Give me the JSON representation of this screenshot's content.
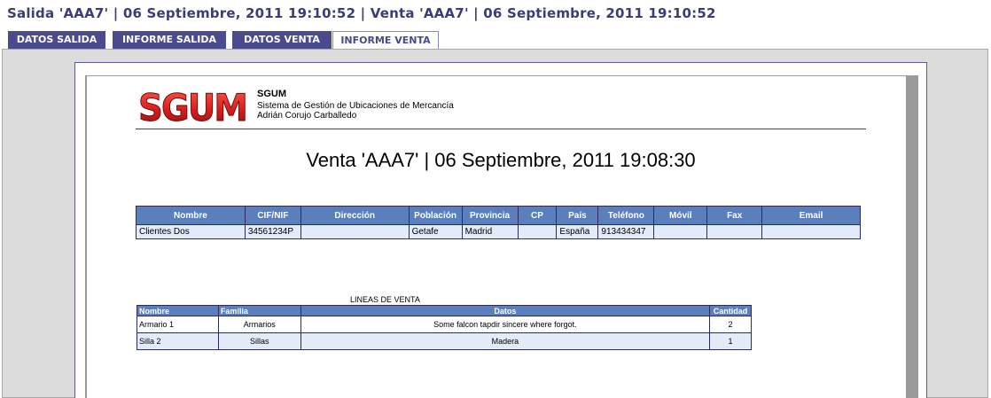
{
  "header": {
    "title": "Salida 'AAA7' | 06 Septiembre, 2011 19:10:52 | Venta 'AAA7' | 06 Septiembre, 2011 19:10:52"
  },
  "tabs": [
    {
      "label": "DATOS SALIDA"
    },
    {
      "label": "INFORME SALIDA"
    },
    {
      "label": "DATOS VENTA"
    },
    {
      "label": "INFORME VENTA"
    }
  ],
  "report": {
    "logo_text": "SGUM",
    "company_name": "SGUM",
    "company_line1": "Sistema de Gestión de Ubicaciones de Mercancía",
    "company_line2": "Adrián Corujo Carballedo",
    "title": "Venta 'AAA7' | 06 Septiembre, 2011 19:08:30",
    "client_table": {
      "headers": [
        "Nombre",
        "CIF/NIF",
        "Dirección",
        "Población",
        "Provincia",
        "CP",
        "País",
        "Teléfono",
        "Móvil",
        "Fax",
        "Email"
      ],
      "row": [
        "Clientes Dos",
        "34561234P",
        "",
        "Getafe",
        "Madrid",
        "",
        "España",
        "913434347",
        "",
        "",
        ""
      ]
    },
    "lines_caption": "LINEAS DE VENTA",
    "lines_table": {
      "headers": [
        "Nombre",
        "Familia",
        "Datos",
        "Cantidad"
      ],
      "rows": [
        [
          "Armario 1",
          "Armarios",
          "Some falcon tapdir sincere where forgot.",
          "2"
        ],
        [
          "Silla 2",
          "Sillas",
          "Madera",
          "1"
        ]
      ]
    }
  },
  "colors": {
    "accent": "#4a4a8c",
    "table_header": "#5b7fbd",
    "logo_red": "#d81e1e"
  }
}
